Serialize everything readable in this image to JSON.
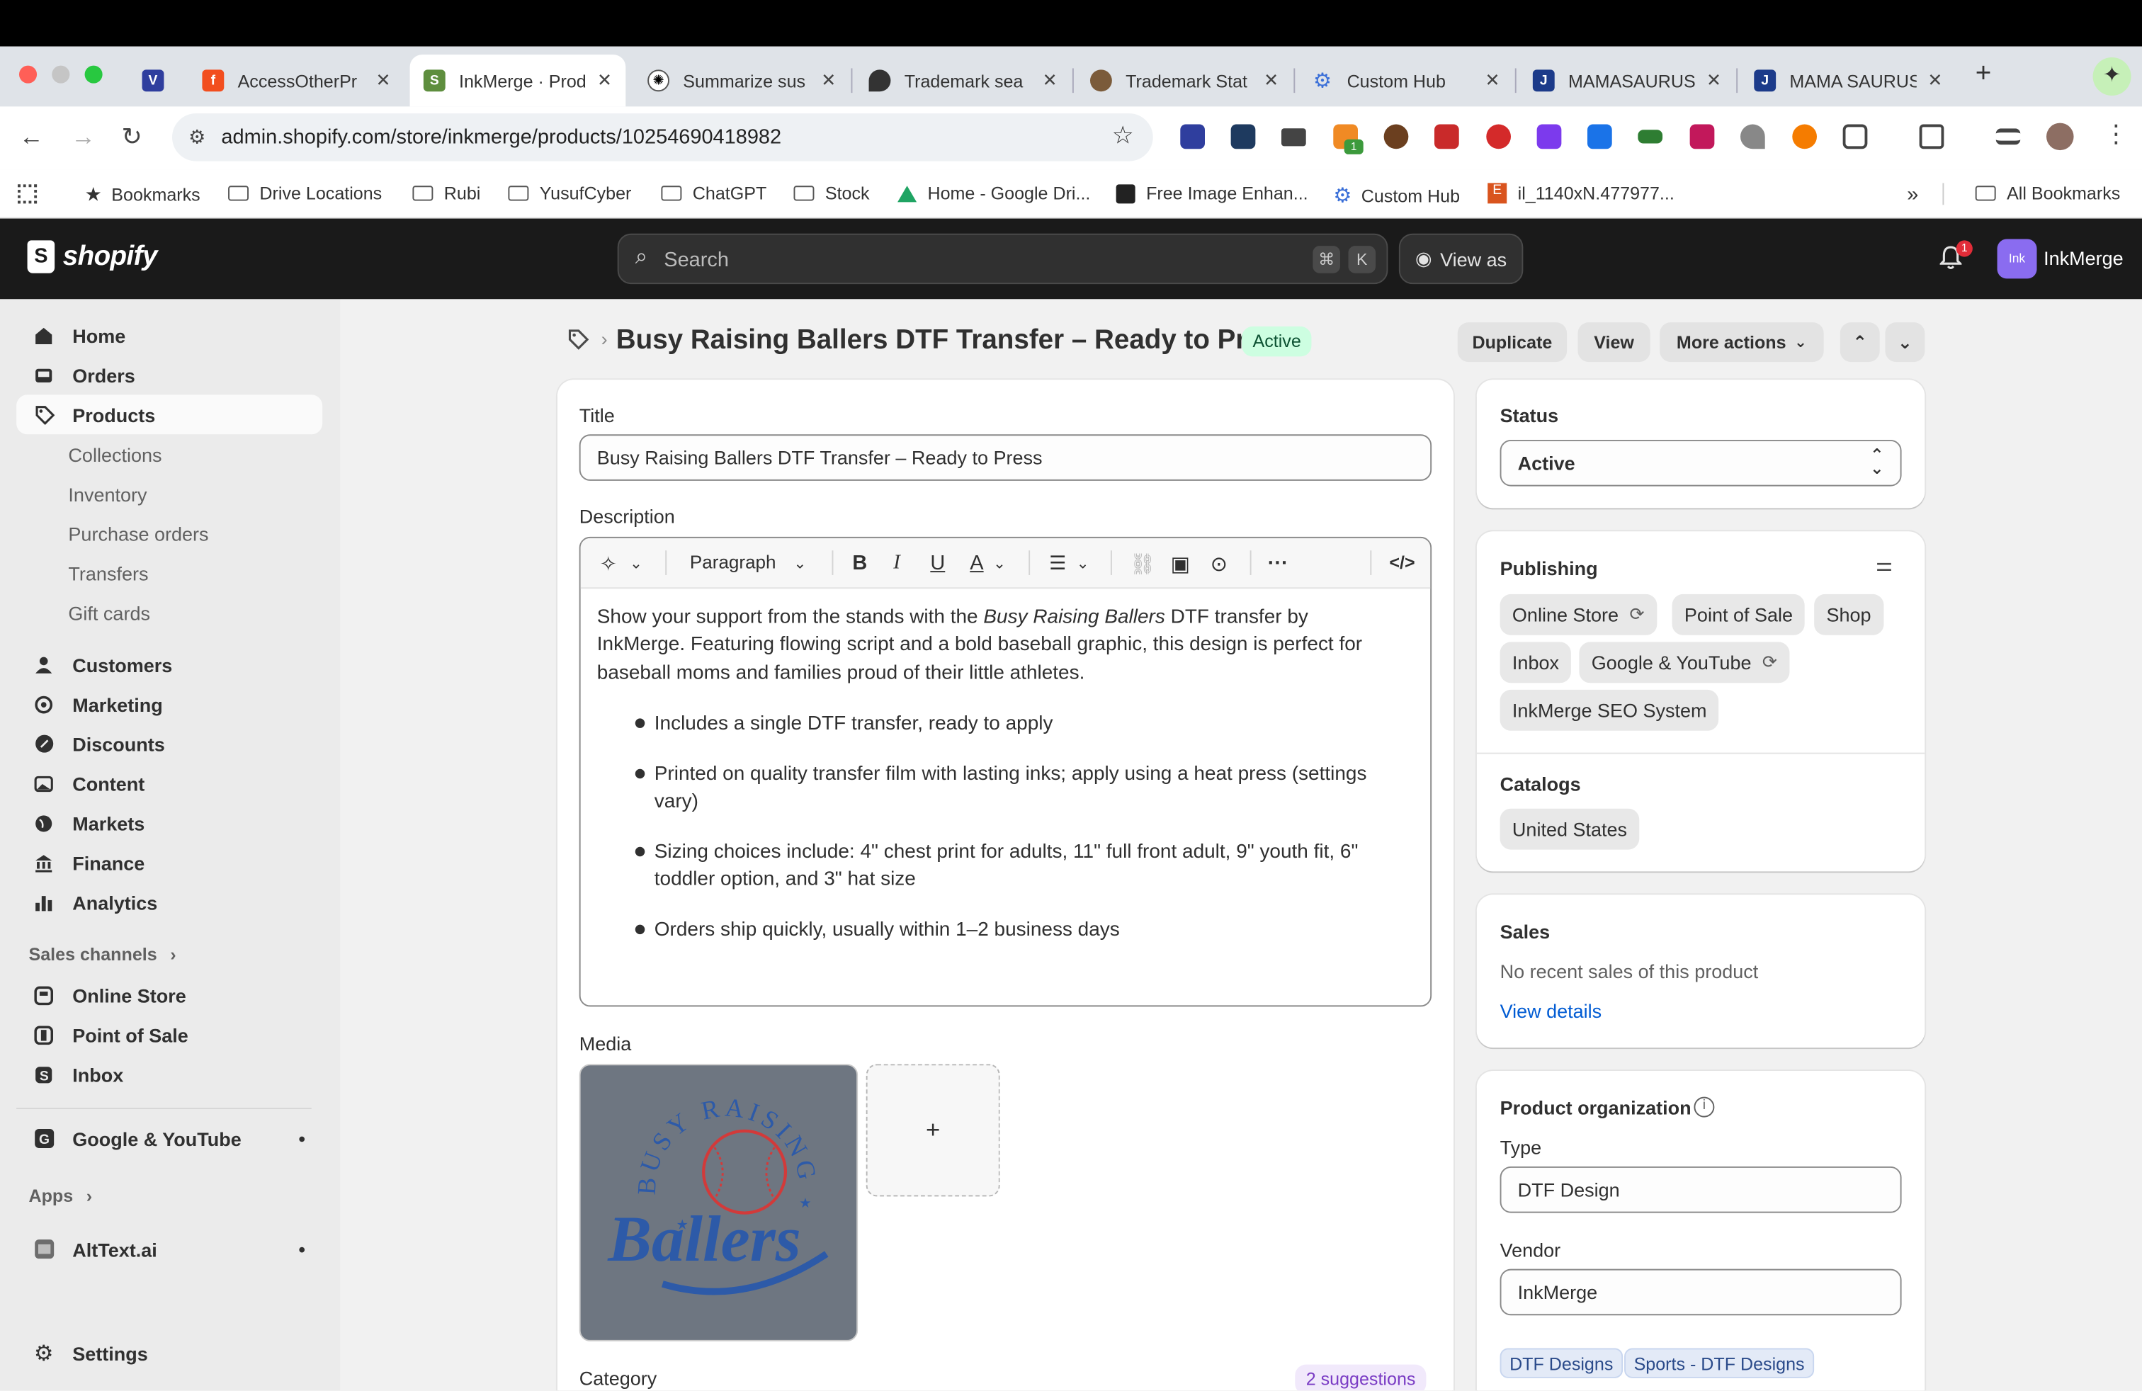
{
  "browser": {
    "tabs": [
      {
        "label": "",
        "favicon": "v-logo-icon"
      },
      {
        "label": "AccessOtherPr",
        "favicon": "figma-icon"
      },
      {
        "label": "InkMerge · Prod",
        "favicon": "shopify-icon",
        "active": true
      },
      {
        "label": "Summarize sus",
        "favicon": "openai-icon"
      },
      {
        "label": "Trademark sea",
        "favicon": "map-pin-icon"
      },
      {
        "label": "Trademark Stat",
        "favicon": "avatar-icon"
      },
      {
        "label": "Custom Hub",
        "favicon": "gear-icon"
      },
      {
        "label": "MAMASAURUS",
        "favicon": "j-icon"
      },
      {
        "label": "MAMA SAURUS",
        "favicon": "j-icon"
      }
    ],
    "url": "admin.shopify.com/store/inkmerge/products/10254690418982",
    "bookmarks": [
      {
        "label": "Bookmarks",
        "icon": "star-icon"
      },
      {
        "label": "Drive Locations",
        "icon": "folder-icon"
      },
      {
        "label": "Rubi",
        "icon": "folder-icon"
      },
      {
        "label": "YusufCyber",
        "icon": "folder-icon"
      },
      {
        "label": "ChatGPT",
        "icon": "folder-icon"
      },
      {
        "label": "Stock",
        "icon": "folder-icon"
      },
      {
        "label": "Home - Google Dri...",
        "icon": "google-drive-icon"
      },
      {
        "label": "Free Image Enhan...",
        "icon": "c-icon"
      },
      {
        "label": "Custom Hub",
        "icon": "gear-icon"
      },
      {
        "label": "il_1140xN.477977...",
        "icon": "etsy-icon"
      }
    ],
    "more_bookmarks": "»",
    "all_bookmarks": "All Bookmarks",
    "extension_badge": "1"
  },
  "header": {
    "logo": "shopify",
    "search_placeholder": "Search",
    "shortcut_keys": [
      "⌘",
      "K"
    ],
    "view_as": "View as",
    "notification_count": "1",
    "store_initials": "Ink",
    "store_name": "InkMerge"
  },
  "sidebar": {
    "main": [
      "Home",
      "Orders",
      "Products"
    ],
    "products_sub": [
      "Collections",
      "Inventory",
      "Purchase orders",
      "Transfers",
      "Gift cards"
    ],
    "more": [
      "Customers",
      "Marketing",
      "Discounts",
      "Content",
      "Markets",
      "Finance",
      "Analytics"
    ],
    "sales_channels_label": "Sales channels",
    "channels": [
      "Online Store",
      "Point of Sale",
      "Inbox"
    ],
    "google": "Google & YouTube",
    "apps_label": "Apps",
    "apps": [
      "AltText.ai"
    ],
    "settings": "Settings"
  },
  "product": {
    "page_title": "Busy Raising Ballers DTF Transfer – Ready to Press",
    "status_badge": "Active",
    "actions": {
      "duplicate": "Duplicate",
      "view": "View",
      "more": "More actions"
    },
    "title_label": "Title",
    "title_value": "Busy Raising Ballers DTF Transfer – Ready to Press",
    "description_label": "Description",
    "editor_paragraph": "Paragraph",
    "desc_intro_pre": "Show your support from the stands with the ",
    "desc_intro_em": "Busy Raising Ballers",
    "desc_intro_post": " DTF transfer by",
    "desc_line2": "InkMerge. Featuring flowing script and a bold baseball graphic, this design is perfect for",
    "desc_line3": "baseball moms and families proud of their little athletes.",
    "bullets": [
      [
        "Includes a single DTF transfer, ready to apply"
      ],
      [
        "Printed on quality transfer film with lasting inks; apply using a heat press (settings",
        "vary)"
      ],
      [
        "Sizing choices include: 4\" chest print for adults, 11\" full front adult, 9\" youth fit, 6\"",
        "toddler option, and 3\" hat size"
      ],
      [
        "Orders ship quickly, usually within 1–2 business days"
      ]
    ],
    "media_label": "Media",
    "media_image_text": {
      "top": "BUSY RAISING",
      "main": "Ballers"
    },
    "add_media": "+",
    "category_label": "Category",
    "category_suggestions": "2 suggestions"
  },
  "right": {
    "status_label": "Status",
    "status_value": "Active",
    "publishing_label": "Publishing",
    "channels": [
      "Online Store",
      "Point of Sale",
      "Shop",
      "Inbox",
      "Google & YouTube",
      "InkMerge SEO System"
    ],
    "catalogs_label": "Catalogs",
    "catalogs": [
      "United States"
    ],
    "sales_label": "Sales",
    "sales_text": "No recent sales of this product",
    "sales_link": "View details",
    "org_label": "Product organization",
    "type_label": "Type",
    "type_value": "DTF Design",
    "vendor_label": "Vendor",
    "vendor_value": "InkMerge",
    "tags": [
      "DTF Designs",
      "Sports - DTF Designs"
    ]
  },
  "colors": {
    "active_green_bg": "#cdfee1",
    "active_green_text": "#0c5132",
    "link_blue": "#005bd3",
    "suggest_purple": "#7a3cc4",
    "header_dark": "#1a1a1a"
  }
}
